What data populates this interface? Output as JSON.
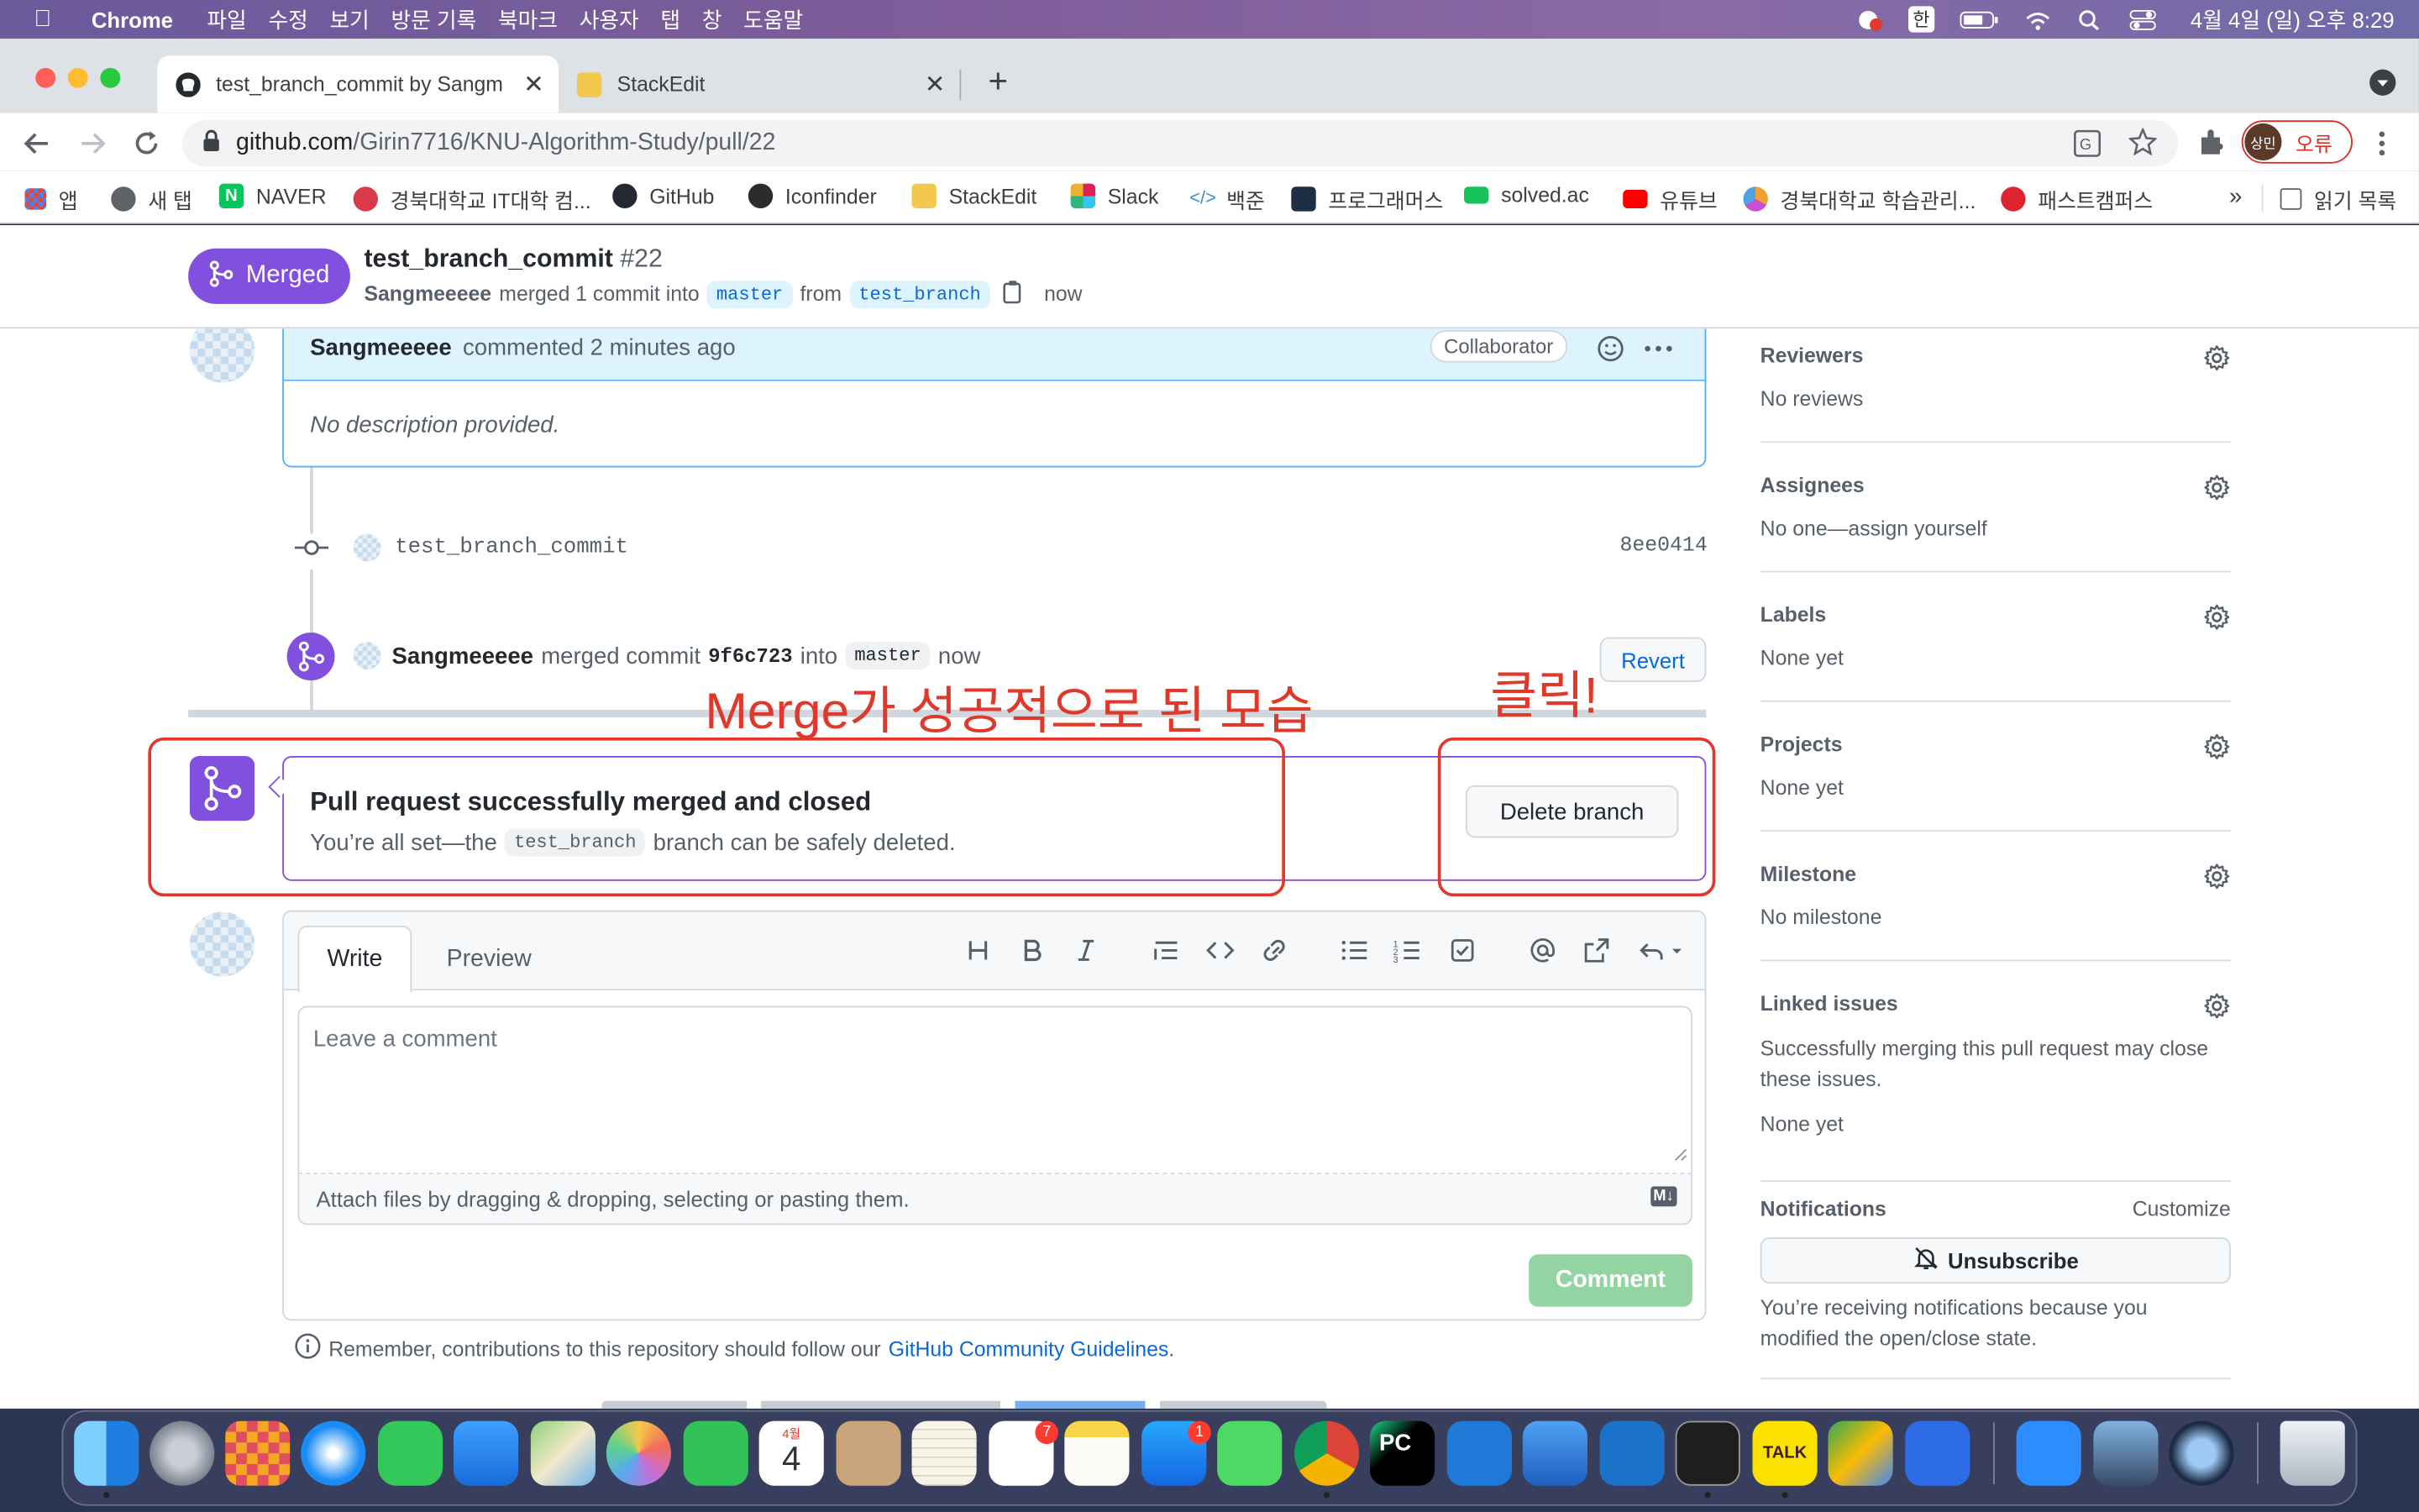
{
  "menubar": {
    "app": "Chrome",
    "items": [
      "파일",
      "수정",
      "보기",
      "방문 기록",
      "북마크",
      "사용자",
      "탭",
      "창",
      "도움말"
    ],
    "input_method": "한",
    "clock": "4월 4일 (일) 오후 8:29"
  },
  "browser": {
    "tabs": [
      {
        "title": "test_branch_commit by Sangm",
        "active": true
      },
      {
        "title": "StackEdit",
        "active": false
      }
    ],
    "new_tab": "+",
    "url_host": "github.com",
    "url_path": "/Girin7716/KNU-Algorithm-Study/pull/22",
    "profile_initials": "상민",
    "profile_status": "오류",
    "bookmarks": [
      {
        "label": "앱",
        "color": "#4285f4"
      },
      {
        "label": "새 탭",
        "color": "#5f6368"
      },
      {
        "label": "NAVER",
        "color": "#03c75a"
      },
      {
        "label": "경북대학교 IT대학 컴...",
        "color": "#d93a4a"
      },
      {
        "label": "GitHub",
        "color": "#24292f"
      },
      {
        "label": "Iconfinder",
        "color": "#2c2c2c"
      },
      {
        "label": "StackEdit",
        "color": "#f2c94c"
      },
      {
        "label": "Slack",
        "color": "#e01e5a"
      },
      {
        "label": "백준",
        "color": "#3a8fd9"
      },
      {
        "label": "프로그래머스",
        "color": "#1e2e44"
      },
      {
        "label": "solved.ac",
        "color": "#16c25a"
      },
      {
        "label": "유튜브",
        "color": "#ff0000"
      },
      {
        "label": "경북대학교 학습관리...",
        "color": "#f0a030"
      },
      {
        "label": "패스트캠퍼스",
        "color": "#e0242f"
      }
    ],
    "more": "»",
    "reading_list": "읽기 목록"
  },
  "pr_header": {
    "state": "Merged",
    "title": "test_branch_commit",
    "number": "#22",
    "author": "Sangmeeeee",
    "merge_text": "merged 1 commit into",
    "base": "master",
    "from": "from",
    "head": "test_branch",
    "time": "now"
  },
  "comment": {
    "author": "Sangmeeeee",
    "meta": "commented 2 minutes ago",
    "role": "Collaborator",
    "body": "No description provided."
  },
  "commit": {
    "message": "test_branch_commit",
    "sha": "8ee0414"
  },
  "merge_event": {
    "author": "Sangmeeeee",
    "text1": "merged commit",
    "sha": "9f6c723",
    "text2": "into",
    "base": "master",
    "time": "now",
    "revert": "Revert"
  },
  "annotations": {
    "merge_note": "Merge가 성공적으로 된 모습",
    "click_note": "클릭!"
  },
  "merged_box": {
    "title": "Pull request successfully merged and closed",
    "desc_pre": "You’re all set—the",
    "branch": "test_branch",
    "desc_post": "branch can be safely deleted.",
    "button": "Delete branch"
  },
  "editor": {
    "tab_write": "Write",
    "tab_preview": "Preview",
    "placeholder": "Leave a comment",
    "attach": "Attach files by dragging & dropping, selecting or pasting them.",
    "md_badge": "M↓",
    "submit": "Comment",
    "guidelines_pre": "Remember, contributions to this repository should follow our",
    "guidelines_link": "GitHub Community Guidelines",
    "guidelines_post": "."
  },
  "sidebar": {
    "sections": [
      {
        "heading": "Reviewers",
        "value": "No reviews"
      },
      {
        "heading": "Assignees",
        "value": "No one—assign yourself"
      },
      {
        "heading": "Labels",
        "value": "None yet"
      },
      {
        "heading": "Projects",
        "value": "None yet"
      },
      {
        "heading": "Milestone",
        "value": "No milestone"
      },
      {
        "heading": "Linked issues",
        "value": "Successfully merging this pull request may close these issues.",
        "value2": "None yet"
      }
    ],
    "notifications": {
      "heading": "Notifications",
      "customize": "Customize",
      "button": "Unsubscribe",
      "note": "You’re receiving notifications because you modified the open/close state."
    }
  },
  "dock": {
    "calendar_month": "4월",
    "calendar_day": "4",
    "reminders_badge": "7",
    "appstore_badge": "1",
    "pycharm": "PC",
    "talk": "TALK"
  },
  "colors": {
    "merged": "#8250df",
    "link": "#0969da",
    "annotation": "#e0382a",
    "comment_button": "#94d3a2"
  }
}
